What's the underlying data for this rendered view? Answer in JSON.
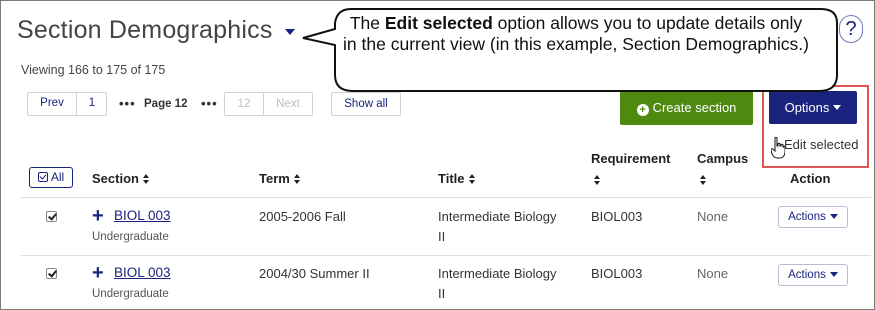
{
  "header": {
    "title": "Section Demographics",
    "viewing": "Viewing 166 to 175 of 175",
    "help_symbol": "?"
  },
  "pagination": {
    "prev": "Prev",
    "first_page": "1",
    "ellipsis": "•••",
    "current_page": "Page 12",
    "last_page": "12",
    "next": "Next",
    "show_all": "Show all"
  },
  "toolbar": {
    "create_section": "Create section",
    "options": "Options",
    "menu_items": [
      "Edit selected"
    ]
  },
  "callout": {
    "prefix": "The ",
    "bold": "Edit selected",
    "rest": " option allows you to update details only in the current view (in this example, Section Demographics.)"
  },
  "table": {
    "select_all": "All",
    "columns": {
      "section": "Section",
      "term": "Term",
      "title": "Title",
      "requirement": "Requirement",
      "campus": "Campus",
      "action": "Action"
    },
    "rows": [
      {
        "section": "BIOL 003",
        "level": "Undergraduate",
        "term": "2005-2006 Fall",
        "title_line1": "Intermediate Biology",
        "title_line2": "II",
        "requirement": "BIOL003",
        "campus": "None",
        "action": "Actions",
        "checked": true
      },
      {
        "section": "BIOL 003",
        "level": "Undergraduate",
        "term": "2004/30 Summer II",
        "title_line1": "Intermediate Biology",
        "title_line2": "II",
        "requirement": "BIOL003",
        "campus": "None",
        "action": "Actions",
        "checked": true
      }
    ]
  },
  "colors": {
    "primary": "#1a237e",
    "create": "#4e8a10",
    "highlight": "#e05555"
  },
  "icons": {
    "title_dropdown": "caret-down-icon",
    "help": "question-icon",
    "create": "plus-circle-icon",
    "expand": "plus-icon",
    "sort": "sort-icon",
    "cursor": "hand-pointer-icon"
  }
}
